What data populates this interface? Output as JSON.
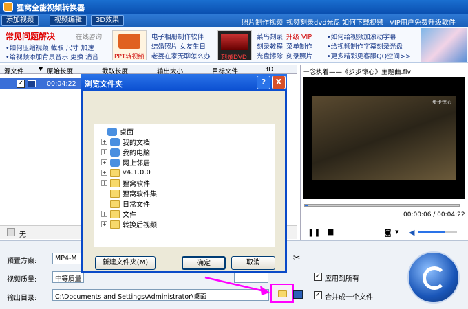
{
  "app": {
    "title": "狸窝全能视频转换器"
  },
  "menu": {
    "tabs": [
      "添加视频",
      "视频编辑",
      "3D效果"
    ],
    "links": [
      "照片制作视频",
      "视频刻录dvd光盘",
      "如何下载视频",
      "VIP用户免费升级软件"
    ]
  },
  "ads": {
    "faq_title": "常见问题解决",
    "consult": "在线咨询",
    "faq_line1": "•如何压缩视频 截取 尺寸 加速",
    "faq_line2": "•给视频添加背景音乐 更换 消音",
    "ppt_label": "PPT转视频",
    "col2": [
      "电子相册制作软件",
      "结婚照片 女友生日",
      "老婆在家无聊怎么办"
    ],
    "dvd_label": "刻录DVD",
    "col3a": [
      "菜鸟刻录",
      "刻录教程",
      "光盘擦除"
    ],
    "col3b": [
      "升级 VIP",
      "菜单制作",
      "刻录照片"
    ],
    "col4": [
      "•如何给视频加滚动字幕",
      "•给视频制作字幕刻录光盘",
      "•更多精彩见客服QQ空间>>"
    ]
  },
  "filelist": {
    "headers": [
      "源文件",
      "原始长度",
      "截取长度",
      "输出大小",
      "目标文件",
      "3D"
    ],
    "row": {
      "duration": "00:04:22"
    }
  },
  "subtitle": {
    "value": "无"
  },
  "preview": {
    "title": "一念执着——《步步惊心》主题曲.flv",
    "watermark": "步步惊心",
    "time": "00:00:06 / 00:04:22",
    "progress": 0.02,
    "volume": 0.7
  },
  "bottom": {
    "preset_label": "预置方案:",
    "preset_value": "MP4-M",
    "quality_label": "视频质量:",
    "quality_value": "中等质量",
    "apply_all": "应用到所有",
    "output_label": "输出目录:",
    "output_value": "C:\\Documents and Settings\\Administrator\\桌面",
    "merge": "合并成一个文件"
  },
  "dialog": {
    "title": "浏览文件夹",
    "help": "?",
    "close": "X",
    "tree": [
      {
        "label": "桌面",
        "level": 0,
        "icon": "desktop-icon",
        "expand": ""
      },
      {
        "label": "我的文档",
        "level": 1,
        "icon": "my-documents-icon",
        "expand": "+"
      },
      {
        "label": "我的电脑",
        "level": 1,
        "icon": "my-computer-icon",
        "expand": "+"
      },
      {
        "label": "网上邻居",
        "level": 1,
        "icon": "network-icon",
        "expand": "+"
      },
      {
        "label": "v4.1.0.0",
        "level": 1,
        "icon": "folder-icon",
        "expand": "+"
      },
      {
        "label": "狸窝软件",
        "level": 1,
        "icon": "folder-icon",
        "expand": "+"
      },
      {
        "label": "狸窝软件集",
        "level": 1,
        "icon": "folder-icon",
        "expand": ""
      },
      {
        "label": "日常文件",
        "level": 1,
        "icon": "folder-icon",
        "expand": ""
      },
      {
        "label": "文件",
        "level": 1,
        "icon": "folder-icon",
        "expand": "+"
      },
      {
        "label": "转换后视频",
        "level": 1,
        "icon": "folder-icon",
        "expand": "+"
      }
    ],
    "new_folder": "新建文件夹(M)",
    "ok": "确定",
    "cancel": "取消"
  },
  "colors": {
    "accent": "#0b4fd1",
    "annotation": "#ff00ff",
    "title_red": "#e00000"
  }
}
